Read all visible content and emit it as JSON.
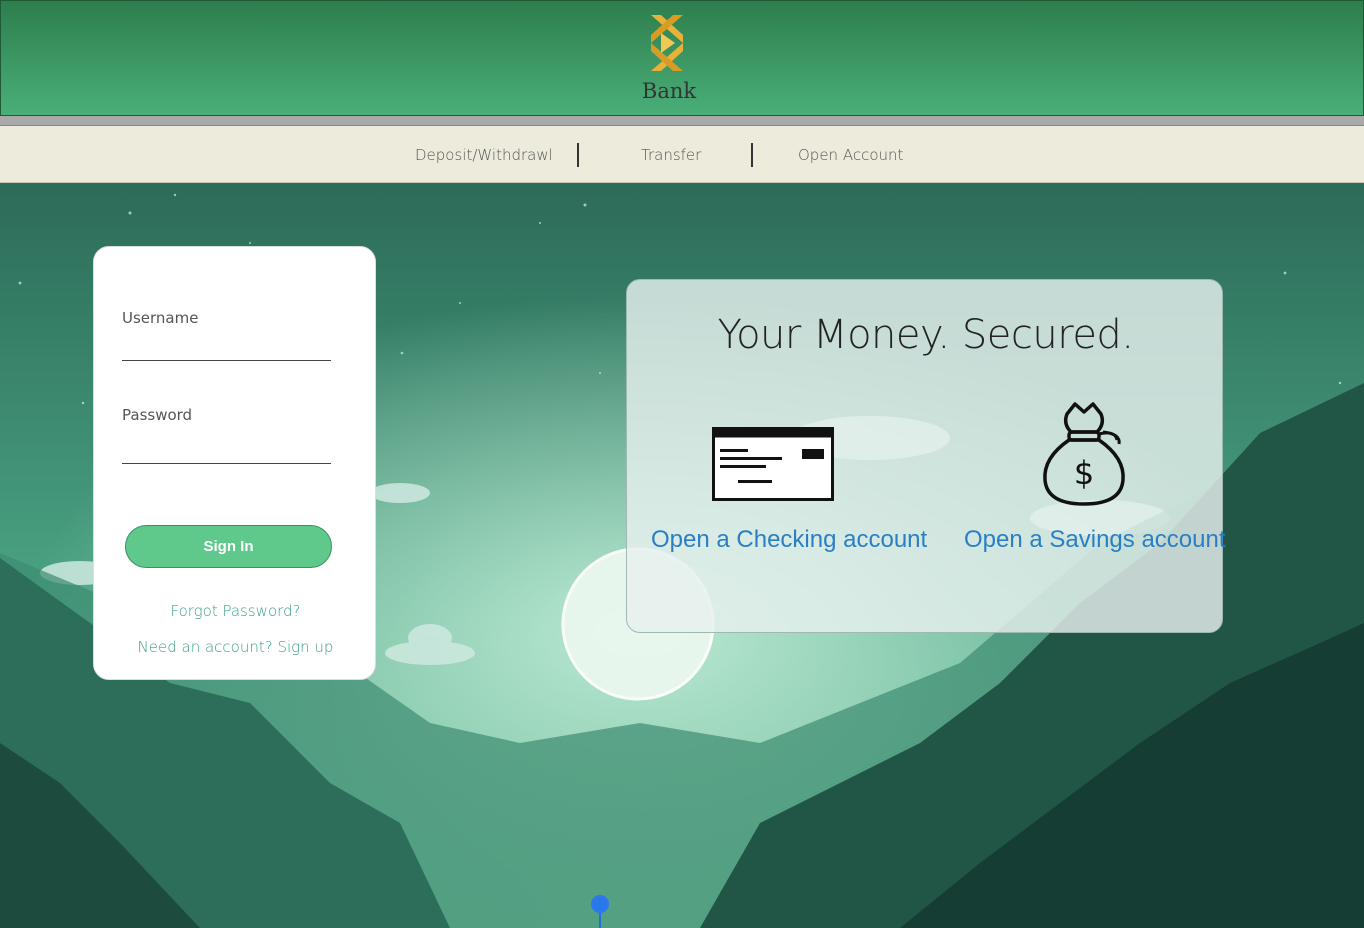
{
  "brand": {
    "name": "Bank",
    "logo_icon": "bank-logo-icon"
  },
  "nav": {
    "items": [
      {
        "label": "Deposit/Withdrawl"
      },
      {
        "label": "Transfer"
      },
      {
        "label": "Open Account"
      }
    ]
  },
  "login": {
    "username_label": "Username",
    "username_value": "",
    "password_label": "Password",
    "password_value": "",
    "signin_label": "Sign In",
    "forgot_label": "Forgot Password?",
    "signup_label": "Need an account? Sign up"
  },
  "promo": {
    "title": "Your Money. Secured.",
    "checking_label": "Open a Checking account",
    "checking_icon": "check-icon",
    "savings_label": "Open a Savings account",
    "savings_icon": "money-bag-icon"
  },
  "colors": {
    "header_top": "#2d7e4c",
    "header_bottom": "#4aae78",
    "nav_bg": "#ecebdc",
    "signin_bg": "#5fc98c",
    "link": "#2a7fc4"
  }
}
